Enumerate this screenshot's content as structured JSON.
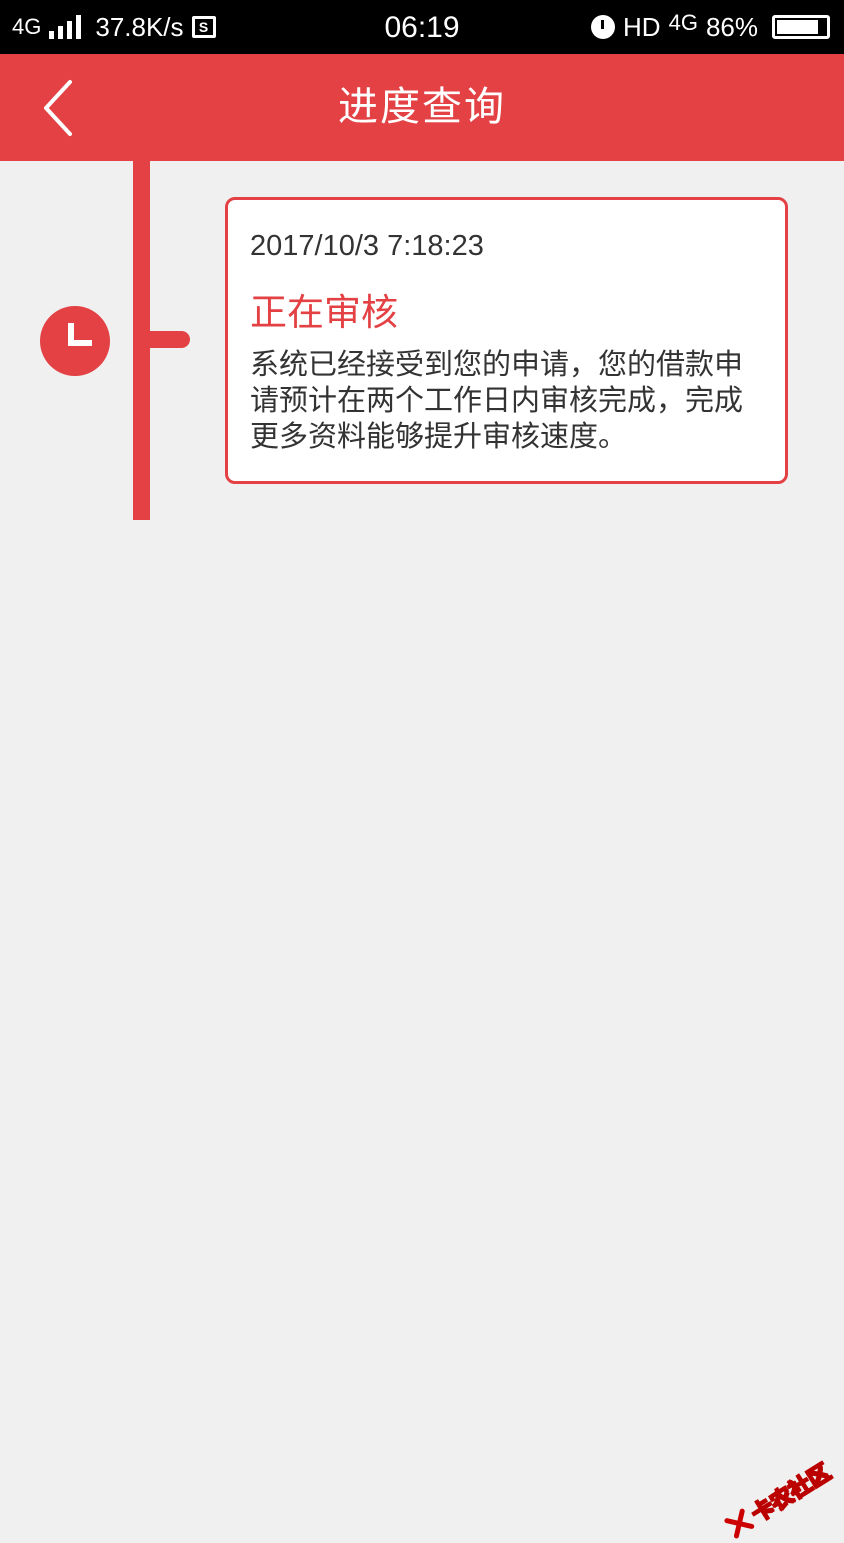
{
  "status_bar": {
    "network": "4G",
    "speed": "37.8K/s",
    "screenshot_glyph": "S",
    "time": "06:19",
    "hd_label": "HD",
    "network_right": "4G",
    "battery_percent": "86%",
    "battery_level": 0.86
  },
  "header": {
    "title": "进度查询",
    "back_icon": "chevron-left-icon",
    "background_color": "#e34144"
  },
  "timeline": {
    "node_icon": "clock-icon",
    "accent_color": "#e34144",
    "entries": [
      {
        "timestamp": "2017/10/3 7:18:23",
        "status": "正在审核",
        "description": "系统已经接受到您的申请，您的借款申请预计在两个工作日内审核完成，完成更多资料能够提升审核速度。"
      }
    ]
  },
  "watermark": {
    "text": "卡农社区"
  }
}
